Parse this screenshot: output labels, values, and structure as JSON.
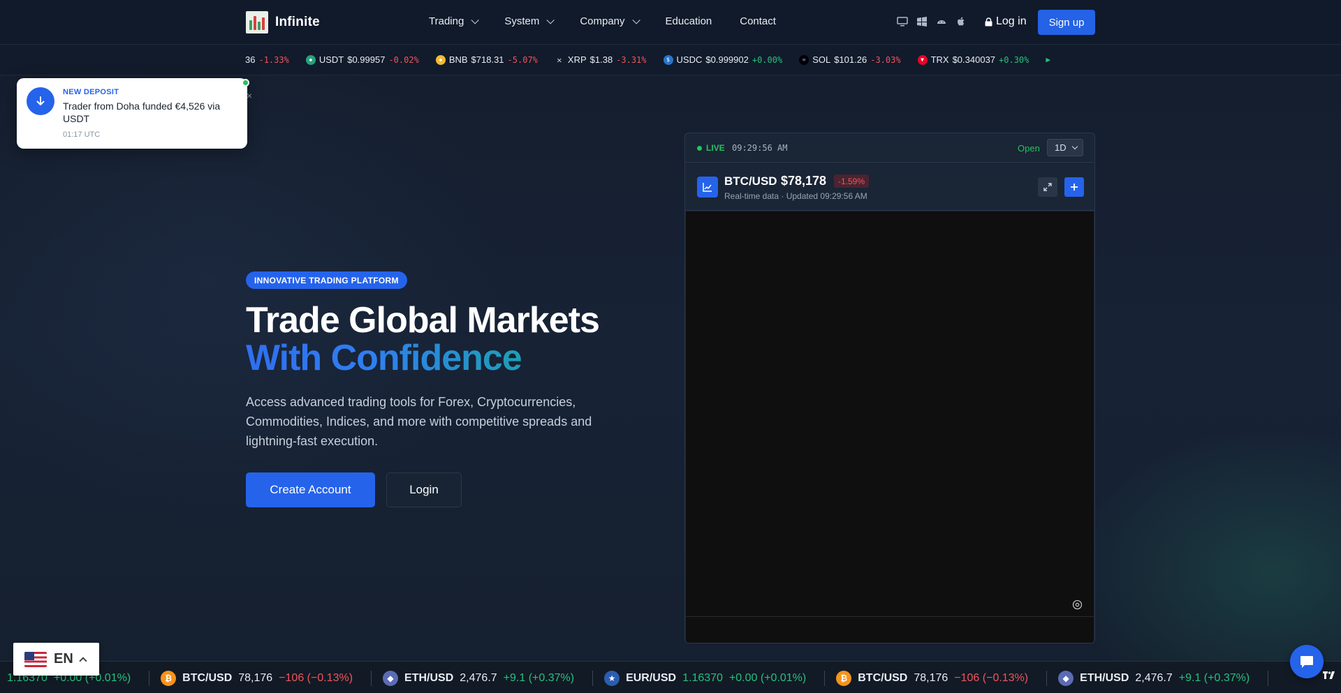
{
  "header": {
    "brand": "Infinite",
    "nav": [
      {
        "label": "Trading",
        "has_dropdown": true
      },
      {
        "label": "System",
        "has_dropdown": true
      },
      {
        "label": "Company",
        "has_dropdown": true
      },
      {
        "label": "Education",
        "has_dropdown": false
      },
      {
        "label": "Contact",
        "has_dropdown": false
      }
    ],
    "platform_icons": [
      "desktop-icon",
      "windows-icon",
      "android-icon",
      "apple-icon"
    ],
    "login_label": "Log in",
    "signup_label": "Sign up"
  },
  "top_ticker": [
    {
      "symbol": "",
      "price": "36",
      "change": "-1.33%",
      "direction": "neg",
      "icon": ""
    },
    {
      "symbol": "USDT",
      "price": "$0.99957",
      "change": "-0.02%",
      "direction": "neg",
      "icon": "usdt-icon",
      "color": "#26a17b"
    },
    {
      "symbol": "BNB",
      "price": "$718.31",
      "change": "-5.07%",
      "direction": "neg",
      "icon": "bnb-icon",
      "color": "#f3ba2f"
    },
    {
      "symbol": "XRP",
      "price": "$1.38",
      "change": "-3.31%",
      "direction": "neg",
      "icon": "xrp-icon",
      "color": "#23292f"
    },
    {
      "symbol": "USDC",
      "price": "$0.999902",
      "change": "+0.00%",
      "direction": "pos",
      "icon": "usdc-icon",
      "color": "#2775ca"
    },
    {
      "symbol": "SOL",
      "price": "$101.26",
      "change": "-3.03%",
      "direction": "neg",
      "icon": "sol-icon",
      "color": "#000000"
    },
    {
      "symbol": "TRX",
      "price": "$0.340037",
      "change": "+0.30%",
      "direction": "pos",
      "icon": "trx-icon",
      "color": "#eb0029"
    }
  ],
  "toast": {
    "title": "NEW DEPOSIT",
    "message": "Trader from Doha funded €4,526 via USDT",
    "time": "01:17 UTC",
    "close": "×"
  },
  "hero": {
    "badge": "INNOVATIVE TRADING PLATFORM",
    "title_line1": "Trade Global Markets",
    "title_line2": "With Confidence",
    "lead": "Access advanced trading tools for Forex, Cryptocurrencies, Commodities, Indices, and more with competitive spreads and lightning-fast execution.",
    "primary_cta": "Create Account",
    "secondary_cta": "Login"
  },
  "widget": {
    "live_label": "LIVE",
    "live_time": "09:29:56 AM",
    "open_label": "Open",
    "timeframe": "1D",
    "pair": "BTC/USD",
    "price": "$78,178",
    "change": "-1.59%",
    "subinfo": "Real-time data · Updated 09:29:56 AM"
  },
  "bottom_ticker": [
    {
      "symbol": "",
      "price": "1.16370",
      "change": "+0.00 (+0.01%)",
      "direction": "pos",
      "icon": ""
    },
    {
      "symbol": "BTC/USD",
      "price": "78,176",
      "change": "−106 (−0.13%)",
      "direction": "neg",
      "icon": "btc-icon",
      "color": "#f7931a"
    },
    {
      "symbol": "ETH/USD",
      "price": "2,476.7",
      "change": "+9.1 (+0.37%)",
      "direction": "pos",
      "icon": "eth-icon",
      "color": "#5b6bb5"
    },
    {
      "symbol": "EUR/USD",
      "price": "1.16370",
      "change": "+0.00 (+0.01%)",
      "direction": "pos",
      "icon": "eur-usd-flag-icon",
      "color": "#2a5db0"
    },
    {
      "symbol": "BTC/USD",
      "price": "78,176",
      "change": "−106 (−0.13%)",
      "direction": "neg",
      "icon": "btc-icon",
      "color": "#f7931a"
    },
    {
      "symbol": "ETH/USD",
      "price": "2,476.7",
      "change": "+9.1 (+0.37%)",
      "direction": "pos",
      "icon": "eth-icon",
      "color": "#5b6bb5"
    }
  ],
  "language": {
    "code": "EN"
  },
  "colors": {
    "accent": "#2563eb",
    "positive": "#27c07c",
    "negative": "#f0545b",
    "live": "#22c55e"
  }
}
